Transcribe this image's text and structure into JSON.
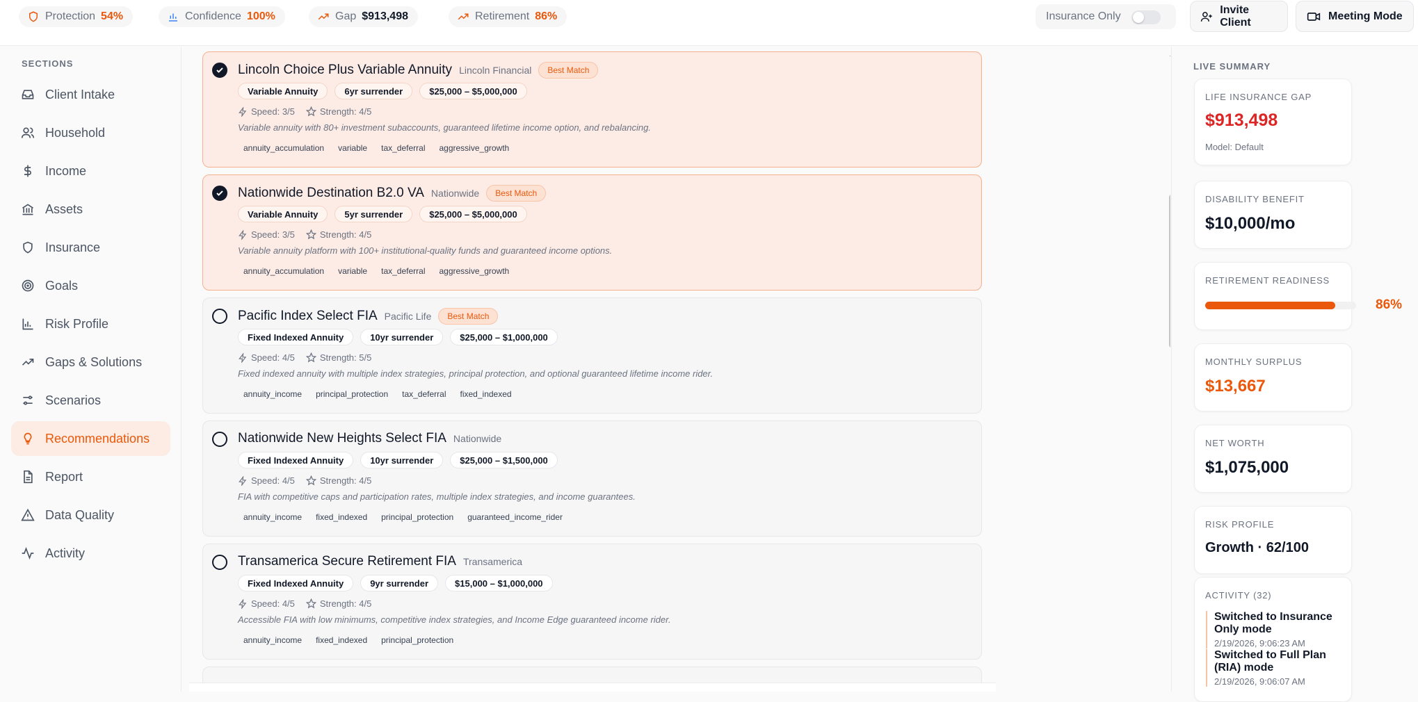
{
  "topbar": {
    "metrics": [
      {
        "label": "Protection",
        "value": "54%",
        "icon": "shield-icon",
        "value_color": "#ea580c"
      },
      {
        "label": "Confidence",
        "value": "100%",
        "icon": "bar-chart-icon",
        "value_color": "#ea580c"
      },
      {
        "label": "Gap",
        "value": "$913,498",
        "icon": "trending-up-icon",
        "value_color": "#111827"
      },
      {
        "label": "Retirement",
        "value": "86%",
        "icon": "trending-up-icon",
        "value_color": "#ea580c"
      }
    ],
    "toggle_label": "Insurance Only",
    "toggle_on": false,
    "invite_label": "Invite Client",
    "meeting_label": "Meeting Mode"
  },
  "sidebar": {
    "section_title": "SECTIONS",
    "items": [
      {
        "label": "Client Intake",
        "icon": "inbox-icon"
      },
      {
        "label": "Household",
        "icon": "users-icon"
      },
      {
        "label": "Income",
        "icon": "dollar-icon"
      },
      {
        "label": "Assets",
        "icon": "bank-icon"
      },
      {
        "label": "Insurance",
        "icon": "shield-icon"
      },
      {
        "label": "Goals",
        "icon": "target-icon"
      },
      {
        "label": "Risk Profile",
        "icon": "bar-chart-icon"
      },
      {
        "label": "Gaps & Solutions",
        "icon": "trending-up-icon"
      },
      {
        "label": "Scenarios",
        "icon": "sliders-icon"
      },
      {
        "label": "Recommendations",
        "icon": "lightbulb-icon",
        "active": true
      },
      {
        "label": "Report",
        "icon": "document-icon"
      },
      {
        "label": "Data Quality",
        "icon": "warning-icon"
      },
      {
        "label": "Activity",
        "icon": "activity-icon"
      }
    ]
  },
  "products": [
    {
      "name": "Lincoln Choice Plus Variable Annuity",
      "carrier": "Lincoln Financial",
      "badge": "Best Match",
      "selected": true,
      "pills": [
        "Variable Annuity",
        "6yr surrender",
        "$25,000 – $5,000,000"
      ],
      "speed": "Speed: 3/5",
      "strength": "Strength: 4/5",
      "description": "Variable annuity with 80+ investment subaccounts, guaranteed lifetime income option, and rebalancing.",
      "tags": [
        "annuity_accumulation",
        "variable",
        "tax_deferral",
        "aggressive_growth"
      ]
    },
    {
      "name": "Nationwide Destination B2.0 VA",
      "carrier": "Nationwide",
      "badge": "Best Match",
      "selected": true,
      "pills": [
        "Variable Annuity",
        "5yr surrender",
        "$25,000 – $5,000,000"
      ],
      "speed": "Speed: 3/5",
      "strength": "Strength: 4/5",
      "description": "Variable annuity platform with 100+ institutional-quality funds and guaranteed income options.",
      "tags": [
        "annuity_accumulation",
        "variable",
        "tax_deferral",
        "aggressive_growth"
      ]
    },
    {
      "name": "Pacific Index Select FIA",
      "carrier": "Pacific Life",
      "badge": "Best Match",
      "selected": false,
      "pills": [
        "Fixed Indexed Annuity",
        "10yr surrender",
        "$25,000 – $1,000,000"
      ],
      "speed": "Speed: 4/5",
      "strength": "Strength: 5/5",
      "description": "Fixed indexed annuity with multiple index strategies, principal protection, and optional guaranteed lifetime income rider.",
      "tags": [
        "annuity_income",
        "principal_protection",
        "tax_deferral",
        "fixed_indexed"
      ]
    },
    {
      "name": "Nationwide New Heights Select FIA",
      "carrier": "Nationwide",
      "badge": "",
      "selected": false,
      "pills": [
        "Fixed Indexed Annuity",
        "10yr surrender",
        "$25,000 – $1,500,000"
      ],
      "speed": "Speed: 4/5",
      "strength": "Strength: 4/5",
      "description": "FIA with competitive caps and participation rates, multiple index strategies, and income guarantees.",
      "tags": [
        "annuity_income",
        "fixed_indexed",
        "principal_protection",
        "guaranteed_income_rider"
      ]
    },
    {
      "name": "Transamerica Secure Retirement FIA",
      "carrier": "Transamerica",
      "badge": "",
      "selected": false,
      "pills": [
        "Fixed Indexed Annuity",
        "9yr surrender",
        "$15,000 – $1,000,000"
      ],
      "speed": "Speed: 4/5",
      "strength": "Strength: 4/5",
      "description": "Accessible FIA with low minimums, competitive index strategies, and Income Edge guaranteed income rider.",
      "tags": [
        "annuity_income",
        "fixed_indexed",
        "principal_protection"
      ]
    }
  ],
  "summary": {
    "title": "LIVE SUMMARY",
    "life_gap": {
      "label": "LIFE INSURANCE GAP",
      "value": "$913,498",
      "sub": "Model: Default",
      "color": "#dc2626"
    },
    "disability": {
      "label": "DISABILITY BENEFIT",
      "value": "$10,000/mo"
    },
    "retirement": {
      "label": "RETIREMENT READINESS",
      "pct": "86%",
      "fraction": 0.86
    },
    "surplus": {
      "label": "MONTHLY SURPLUS",
      "value": "$13,667",
      "color": "#ea580c"
    },
    "net_worth": {
      "label": "NET WORTH",
      "value": "$1,075,000"
    },
    "risk": {
      "label": "RISK PROFILE",
      "value": "Growth · 62/100"
    },
    "activity": {
      "label": "ACTIVITY (32)",
      "items": [
        {
          "title": "Switched to Insurance Only mode",
          "time": "2/19/2026, 9:06:23 AM"
        },
        {
          "title": "Switched to Full Plan (RIA) mode",
          "time": "2/19/2026, 9:06:07 AM"
        }
      ]
    }
  }
}
